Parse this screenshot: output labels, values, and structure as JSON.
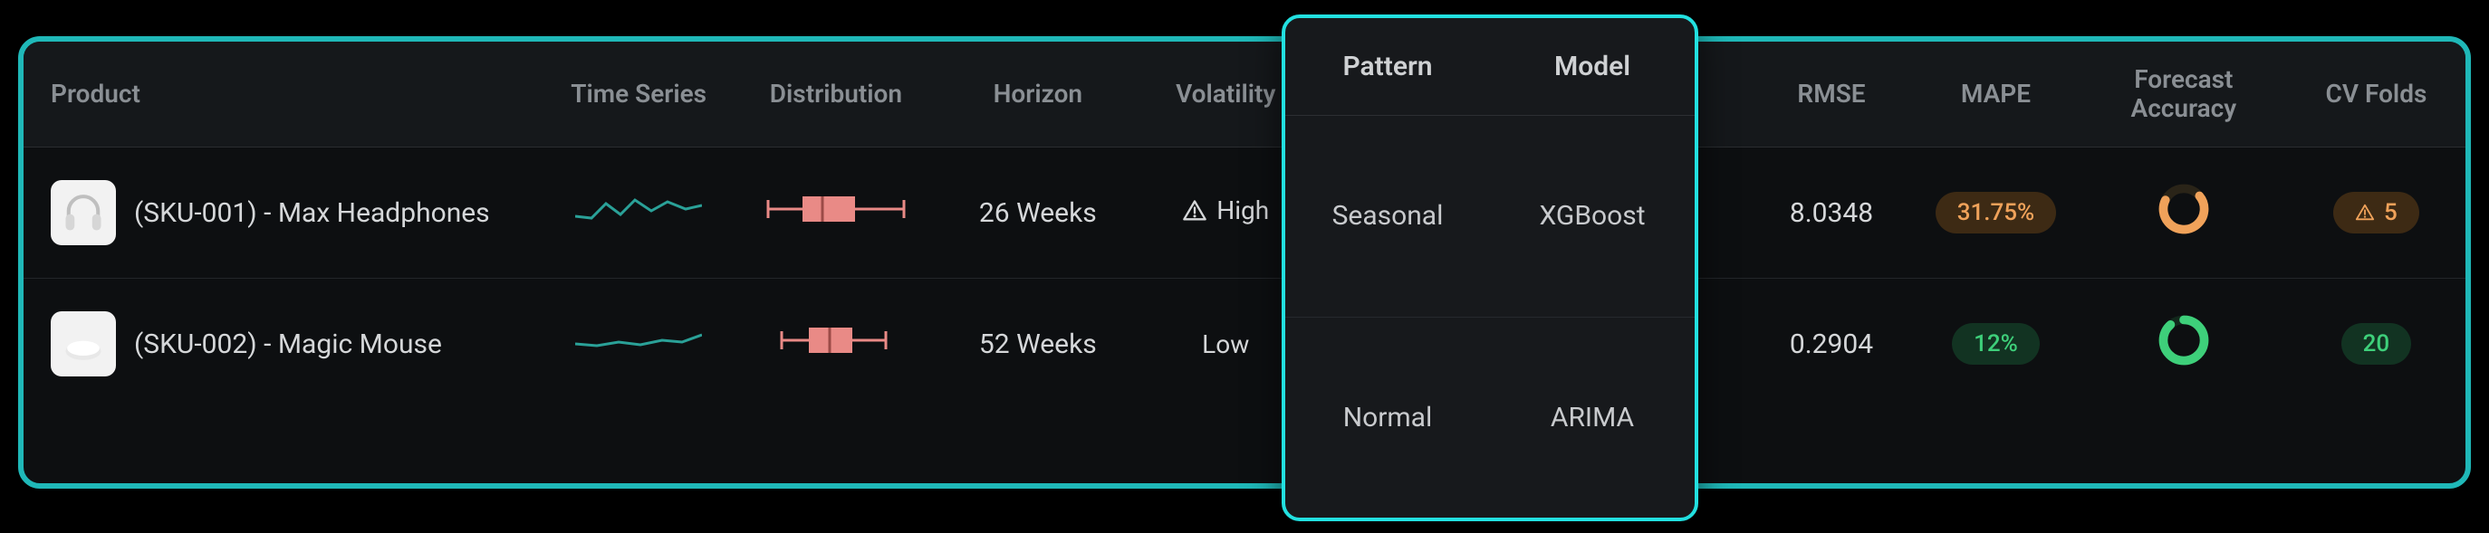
{
  "headers": {
    "product": "Product",
    "time_series": "Time Series",
    "distribution": "Distribution",
    "horizon": "Horizon",
    "volatility": "Volatility",
    "pattern": "Pattern",
    "model": "Model",
    "rmse": "RMSE",
    "mape": "MAPE",
    "forecast_accuracy": "Forecast Accuracy",
    "cv_folds": "CV Folds"
  },
  "rows": [
    {
      "product_label": "(SKU-001) - Max Headphones",
      "horizon": "26 Weeks",
      "volatility_label": "High",
      "volatility_level": "high",
      "pattern": "Seasonal",
      "model": "XGBoost",
      "rmse": "8.0348",
      "mape": "31.75%",
      "mape_level": "warn",
      "accuracy_level": "warn",
      "cv_folds": "5",
      "cv_level": "warn"
    },
    {
      "product_label": "(SKU-002) - Magic Mouse",
      "horizon": "52 Weeks",
      "volatility_label": "Low",
      "volatility_level": "low",
      "pattern": "Normal",
      "model": "ARIMA",
      "rmse": "0.2904",
      "mape": "12%",
      "mape_level": "good",
      "accuracy_level": "good",
      "cv_folds": "20",
      "cv_level": "good"
    }
  ],
  "popover": {
    "pattern_header": "Pattern",
    "model_header": "Model"
  },
  "colors": {
    "teal": "#1fb8b8",
    "green": "#3ecf7a",
    "orange": "#f0a25a",
    "salmon": "#e98a86"
  }
}
